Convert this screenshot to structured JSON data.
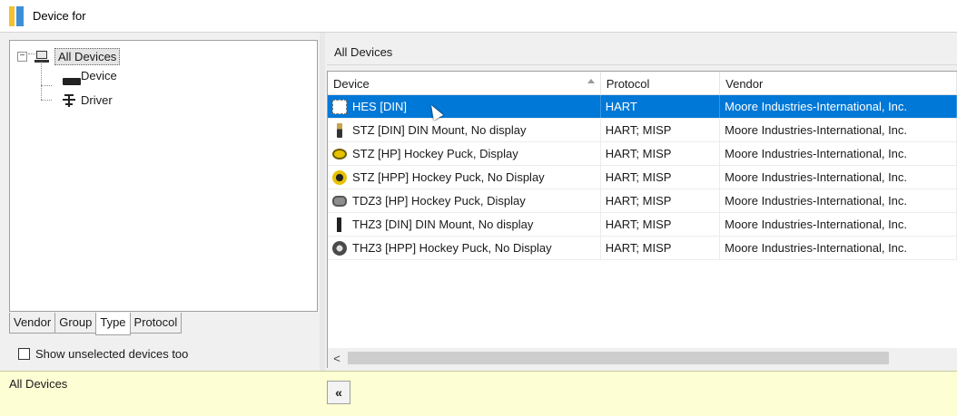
{
  "window": {
    "title": "Device for"
  },
  "tree": {
    "root_label": "All Devices",
    "children": [
      {
        "label": "Device",
        "icon": "device-icon"
      },
      {
        "label": "Driver",
        "icon": "driver-icon"
      }
    ]
  },
  "tabs": [
    "Vendor",
    "Group",
    "Type",
    "Protocol"
  ],
  "active_tab": "Type",
  "show_unselected": {
    "label": "Show unselected devices too",
    "checked": false
  },
  "left_status": "All Devices",
  "right_header": "All Devices",
  "grid": {
    "columns": [
      "Device",
      "Protocol",
      "Vendor"
    ],
    "rows": [
      {
        "device": "HES [DIN]",
        "protocol": "HART",
        "vendor": "Moore Industries-International, Inc.",
        "selected": true
      },
      {
        "device": "STZ [DIN] DIN Mount, No display",
        "protocol": "HART; MISP",
        "vendor": "Moore Industries-International, Inc."
      },
      {
        "device": "STZ [HP] Hockey Puck, Display",
        "protocol": "HART; MISP",
        "vendor": "Moore Industries-International, Inc."
      },
      {
        "device": "STZ [HPP] Hockey Puck, No Display",
        "protocol": "HART; MISP",
        "vendor": "Moore Industries-International, Inc."
      },
      {
        "device": "TDZ3 [HP] Hockey Puck, Display",
        "protocol": "HART; MISP",
        "vendor": "Moore Industries-International, Inc."
      },
      {
        "device": "THZ3 [DIN] DIN Mount, No display",
        "protocol": "HART; MISP",
        "vendor": "Moore Industries-International, Inc."
      },
      {
        "device": "THZ3 [HPP] Hockey Puck, No Display",
        "protocol": "HART; MISP",
        "vendor": "Moore Industries-International, Inc."
      }
    ]
  },
  "scroll": {
    "left_arrow": "<"
  },
  "collapse_button": "«",
  "colors": {
    "selection": "#0078d7",
    "status_bg": "#fefed4"
  }
}
